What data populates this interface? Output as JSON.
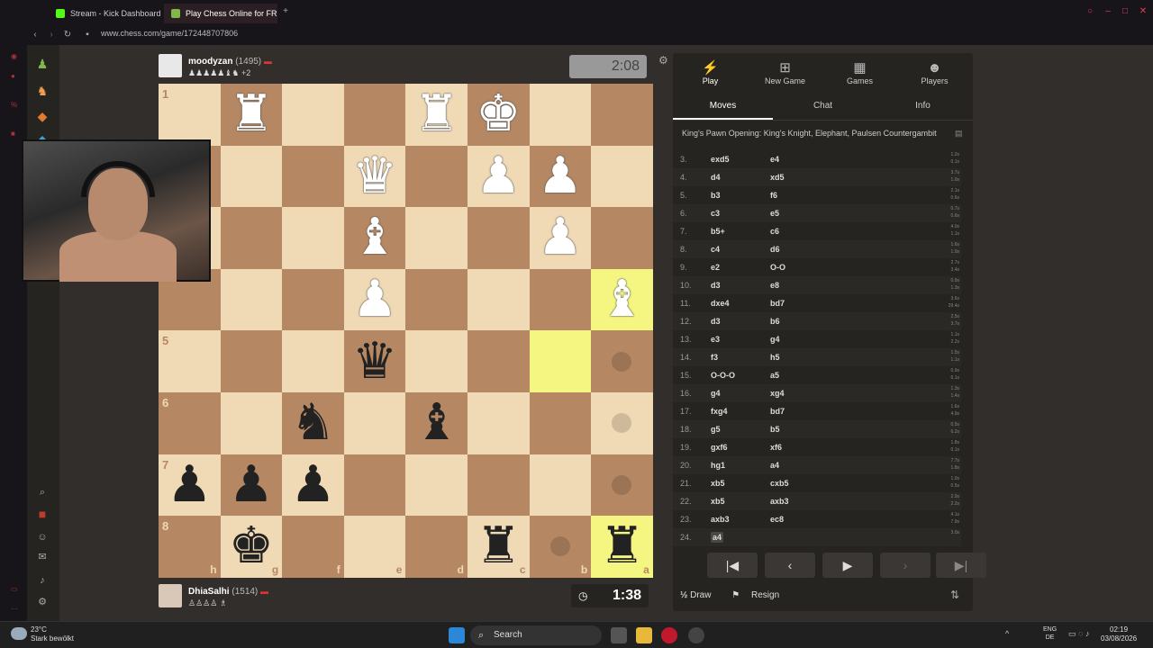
{
  "browser": {
    "tabs": [
      {
        "label": "Stream - Kick Dashboard",
        "active": false
      },
      {
        "label": "Play Chess Online for FREE",
        "active": true
      }
    ],
    "url": "www.chess.com/game/172448707806"
  },
  "top_player": {
    "name": "moodyzan",
    "rating": "(1495)",
    "captured_extra": "+2",
    "clock": "2:08"
  },
  "bottom_player": {
    "name": "DhiaSalhi",
    "rating": "(1514)",
    "clock": "1:38"
  },
  "board": {
    "orientation": "black",
    "rank_labels": [
      "1",
      "5",
      "6",
      "7",
      "8"
    ],
    "file_labels": [
      "h",
      "g",
      "f",
      "e",
      "d",
      "c",
      "b",
      "a"
    ],
    "squares": [
      [
        "",
        "wR",
        "",
        "",
        "wR",
        "wK",
        "",
        ""
      ],
      [
        "",
        "",
        "",
        "wQ",
        "",
        "wP",
        "wP",
        ""
      ],
      [
        "",
        "",
        "",
        "wB",
        "",
        "",
        "wP",
        ""
      ],
      [
        "",
        "",
        "",
        "wP",
        "",
        "",
        "",
        "wB"
      ],
      [
        "",
        "",
        "",
        "bQ",
        "",
        "",
        "",
        ""
      ],
      [
        "",
        "",
        "bN",
        "",
        "bB",
        "",
        "",
        ""
      ],
      [
        "bP",
        "bP",
        "bP",
        "",
        "",
        "",
        "",
        ""
      ],
      [
        "",
        "bK",
        "",
        "",
        "",
        "bR",
        "",
        "bR"
      ]
    ],
    "highlighted": [
      [
        3,
        7
      ],
      [
        4,
        6
      ],
      [
        7,
        7
      ]
    ],
    "move_dots": [
      [
        4,
        7
      ],
      [
        5,
        7
      ],
      [
        6,
        7
      ],
      [
        7,
        6
      ]
    ]
  },
  "panel": {
    "tabs": [
      {
        "label": "Play",
        "icon": "lightning-icon",
        "active": true
      },
      {
        "label": "New Game",
        "icon": "plus-icon",
        "active": false
      },
      {
        "label": "Games",
        "icon": "board-icon",
        "active": false
      },
      {
        "label": "Players",
        "icon": "players-icon",
        "active": false
      }
    ],
    "subtabs": [
      {
        "label": "Moves",
        "active": true
      },
      {
        "label": "Chat",
        "active": false
      },
      {
        "label": "Info",
        "active": false
      }
    ],
    "opening": "King's Pawn Opening: King's Knight, Elephant, Paulsen Countergambit",
    "moves": [
      {
        "n": "3.",
        "w": "exd5",
        "b": "e4",
        "tw": "1.2s",
        "tb": "0.1s"
      },
      {
        "n": "4.",
        "w": "d4",
        "b": "xd5",
        "tw": "3.7s",
        "tb": "1.0s"
      },
      {
        "n": "5.",
        "w": "b3",
        "b": "f6",
        "tw": "2.1s",
        "tb": "0.6s"
      },
      {
        "n": "6.",
        "w": "c3",
        "b": "e5",
        "tw": "0.7s",
        "tb": "0.6s"
      },
      {
        "n": "7.",
        "w": "b5+",
        "b": "c6",
        "tw": "4.0s",
        "tb": "1.1s"
      },
      {
        "n": "8.",
        "w": "c4",
        "b": "d6",
        "tw": "1.6s",
        "tb": "1.0s"
      },
      {
        "n": "9.",
        "w": "e2",
        "b": "O-O",
        "tw": "2.7s",
        "tb": "3.4s"
      },
      {
        "n": "10.",
        "w": "d3",
        "b": "e8",
        "tw": "0.9s",
        "tb": "1.3s"
      },
      {
        "n": "11.",
        "w": "dxe4",
        "b": "bd7",
        "tw": "3.6s",
        "tb": "29.4s"
      },
      {
        "n": "12.",
        "w": "d3",
        "b": "b6",
        "tw": "2.5s",
        "tb": "3.7s"
      },
      {
        "n": "13.",
        "w": "e3",
        "b": "g4",
        "tw": "1.1s",
        "tb": "2.2s"
      },
      {
        "n": "14.",
        "w": "f3",
        "b": "h5",
        "tw": "1.5s",
        "tb": "1.1s"
      },
      {
        "n": "15.",
        "w": "O-O-O",
        "b": "a5",
        "tw": "0.9s",
        "tb": "6.1s"
      },
      {
        "n": "16.",
        "w": "g4",
        "b": "xg4",
        "tw": "1.3s",
        "tb": "1.4s"
      },
      {
        "n": "17.",
        "w": "fxg4",
        "b": "bd7",
        "tw": "1.6s",
        "tb": "4.9s"
      },
      {
        "n": "18.",
        "w": "g5",
        "b": "b5",
        "tw": "0.5s",
        "tb": "6.2s"
      },
      {
        "n": "19.",
        "w": "gxf6",
        "b": "xf6",
        "tw": "1.8s",
        "tb": "0.1s"
      },
      {
        "n": "20.",
        "w": "hg1",
        "b": "a4",
        "tw": "7.7s",
        "tb": "1.8s"
      },
      {
        "n": "21.",
        "w": "xb5",
        "b": "cxb5",
        "tw": "1.0s",
        "tb": "0.5s"
      },
      {
        "n": "22.",
        "w": "xb5",
        "b": "axb3",
        "tw": "2.9s",
        "tb": "2.2s"
      },
      {
        "n": "23.",
        "w": "axb3",
        "b": "ec8",
        "tw": "4.1s",
        "tb": "7.9s"
      },
      {
        "n": "24.",
        "w": "a4",
        "b": "",
        "tw": "3.0s",
        "tb": ""
      }
    ],
    "actions": {
      "draw": "Draw",
      "resign": "Resign",
      "draw_prefix": "½"
    }
  },
  "taskbar": {
    "temperature": "23°C",
    "weather": "Stark bewölkt",
    "search": "Search",
    "lang_top": "ENG",
    "lang_bottom": "DE",
    "time": "02:19",
    "date": "03/08/2026"
  }
}
